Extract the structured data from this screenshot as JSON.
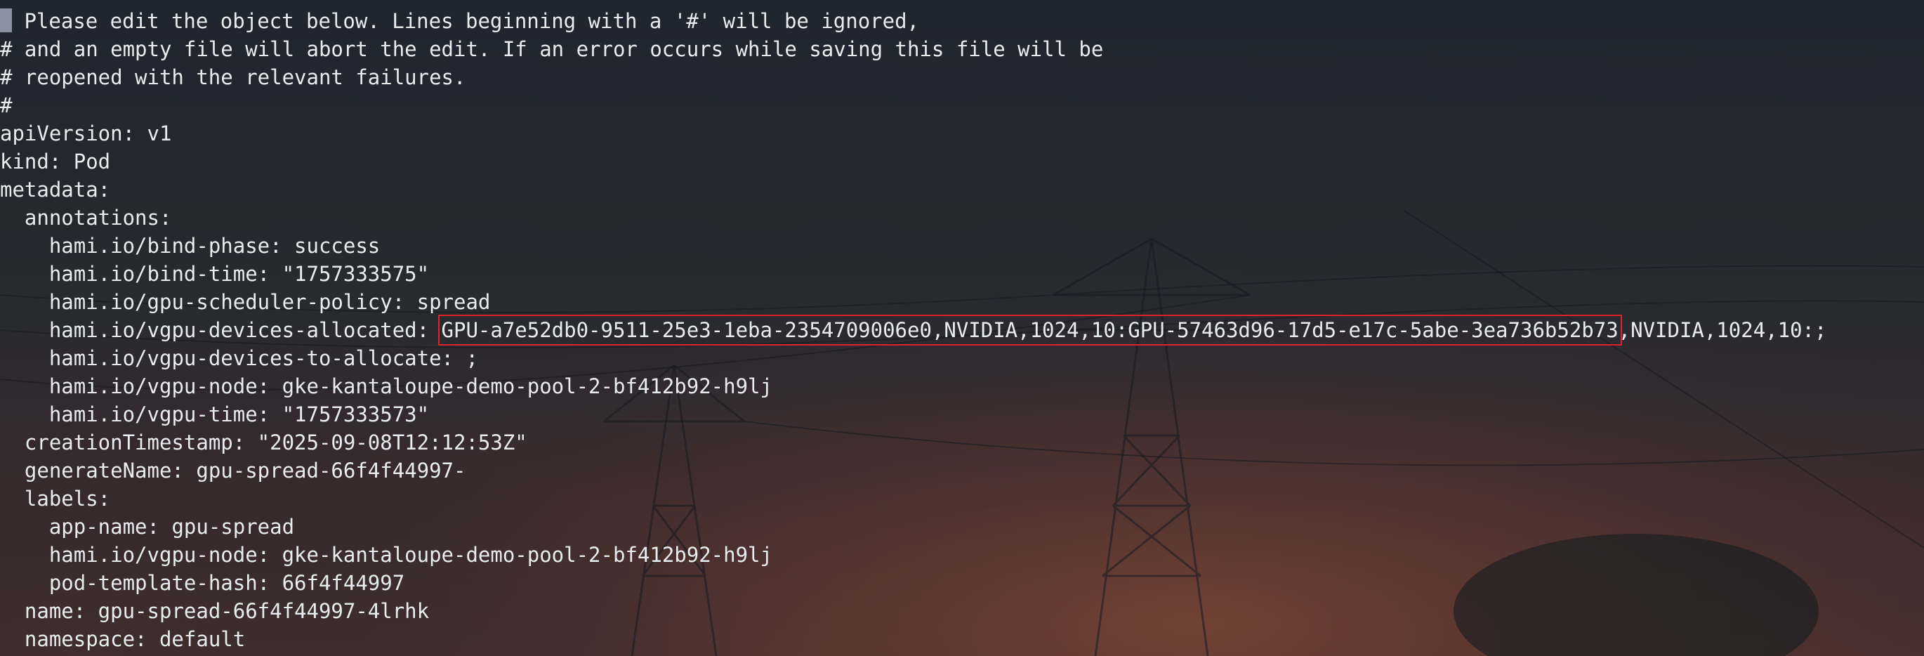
{
  "editor": {
    "lines": [
      {
        "indent": "",
        "text": " Please edit the object below. Lines beginning with a '#' will be ignored,"
      },
      {
        "indent": "",
        "text": "# and an empty file will abort the edit. If an error occurs while saving this file will be"
      },
      {
        "indent": "",
        "text": "# reopened with the relevant failures."
      },
      {
        "indent": "",
        "text": "#"
      },
      {
        "indent": "",
        "text": "apiVersion: v1"
      },
      {
        "indent": "",
        "text": "kind: Pod"
      },
      {
        "indent": "",
        "text": "metadata:"
      },
      {
        "indent": "  ",
        "text": "annotations:"
      },
      {
        "indent": "    ",
        "text": "hami.io/bind-phase: success"
      },
      {
        "indent": "    ",
        "text": "hami.io/bind-time: \"1757333575\""
      },
      {
        "indent": "    ",
        "text": "hami.io/gpu-scheduler-policy: spread"
      },
      {
        "indent": "    ",
        "key": "hami.io/vgpu-devices-allocated: ",
        "highlighted": "GPU-a7e52db0-9511-25e3-1eba-2354709006e0,NVIDIA,1024,10:GPU-57463d96-17d5-e17c-5abe-3ea736b52b73",
        "rest": ",NVIDIA,1024,10:;"
      },
      {
        "indent": "    ",
        "text": "hami.io/vgpu-devices-to-allocate: ;"
      },
      {
        "indent": "    ",
        "text": "hami.io/vgpu-node: gke-kantaloupe-demo-pool-2-bf412b92-h9lj"
      },
      {
        "indent": "    ",
        "text": "hami.io/vgpu-time: \"1757333573\""
      },
      {
        "indent": "  ",
        "text": "creationTimestamp: \"2025-09-08T12:12:53Z\""
      },
      {
        "indent": "  ",
        "text": "generateName: gpu-spread-66f4f44997-"
      },
      {
        "indent": "  ",
        "text": "labels:"
      },
      {
        "indent": "    ",
        "text": "app-name: gpu-spread"
      },
      {
        "indent": "    ",
        "text": "hami.io/vgpu-node: gke-kantaloupe-demo-pool-2-bf412b92-h9lj"
      },
      {
        "indent": "    ",
        "text": "pod-template-hash: 66f4f44997"
      },
      {
        "indent": "  ",
        "text": "name: gpu-spread-66f4f44997-4lrhk"
      },
      {
        "indent": "  ",
        "text": "namespace: default"
      }
    ]
  },
  "colors": {
    "text": "#e9ecef",
    "highlight_border": "#e0232a",
    "cursor": "#8b93a3"
  }
}
